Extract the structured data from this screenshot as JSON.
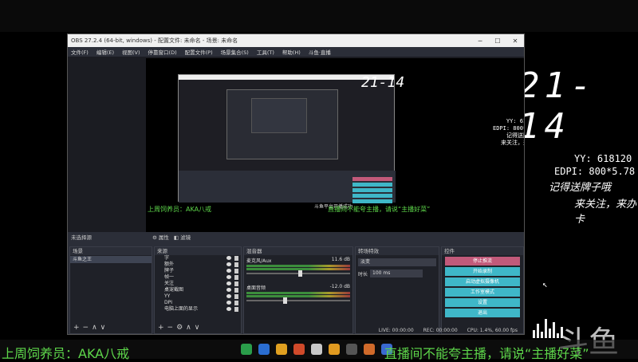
{
  "background": {
    "clock": "21-14",
    "yy": "YY: 618120",
    "edpi": "EDPI: 800*5.78",
    "handwriting_line1": "记得送牌子哦",
    "handwriting_line2": "来关注，来办卡",
    "brand": "斗鱼"
  },
  "subtitle": {
    "left": "上周饲养员：AKA八戒",
    "right": "直播间不能夸主播，请说“主播好菜”"
  },
  "obs": {
    "title": "OBS 27.2.4 (64-bit, windows) - 配置文件: 未命名 - 场景: 未命名",
    "minimize": "─",
    "maximize": "☐",
    "close": "✕",
    "menu": [
      "文件(F)",
      "编辑(E)",
      "视图(V)",
      "停靠窗口(D)",
      "配置文件(P)",
      "场景集合(S)",
      "工具(T)",
      "帮助(H)",
      "斗鱼·直播"
    ],
    "scene_tab_label": "未选择源",
    "properties_label": "属性",
    "filters_label": "滤镜",
    "docks": {
      "scenes": {
        "title": "场景",
        "items": [
          "斗鱼之王"
        ]
      },
      "sources": {
        "title": "来源",
        "items": [
          "字",
          "额外",
          "牌子",
          "帧一",
          "关注",
          "桌宠截图",
          "YY",
          "DPI",
          "电脑上面的显示"
        ]
      },
      "mixer": {
        "title": "混音器",
        "channels": [
          {
            "name": "麦克风/Aux",
            "level": "11.6 dB"
          },
          {
            "name": "桌面音频",
            "level": "-12.0 dB"
          }
        ]
      },
      "transitions": {
        "title": "转场特效",
        "type": "淡变",
        "duration_label": "时长",
        "duration": "100 ms"
      },
      "controls": {
        "title": "控件",
        "buttons": [
          "停止推流",
          "开始录制",
          "启动虚拟摄像机",
          "工作室模式",
          "设置",
          "退出"
        ]
      }
    },
    "status": {
      "live": "LIVE: 00:00:00",
      "rec": "REC: 00:00:00",
      "cpu": "CPU: 1.4%, 60.00 fps"
    }
  },
  "inner": {
    "toast": "斗鱼平台开播成功",
    "clock": "21-14",
    "stats": "YY: 618120\nEDPI: 800*5.78\n记得送牌子哦\n来关注，来办卡",
    "subtitle_left": "上周饲养员：AKA八戒",
    "subtitle_right": "直播间不能夸主播，请说“主播好菜”"
  },
  "colors": {
    "accent_teal": "#3fb7c8",
    "stop_pink": "#c25a7a",
    "subtitle_green": "#5dd64a"
  }
}
